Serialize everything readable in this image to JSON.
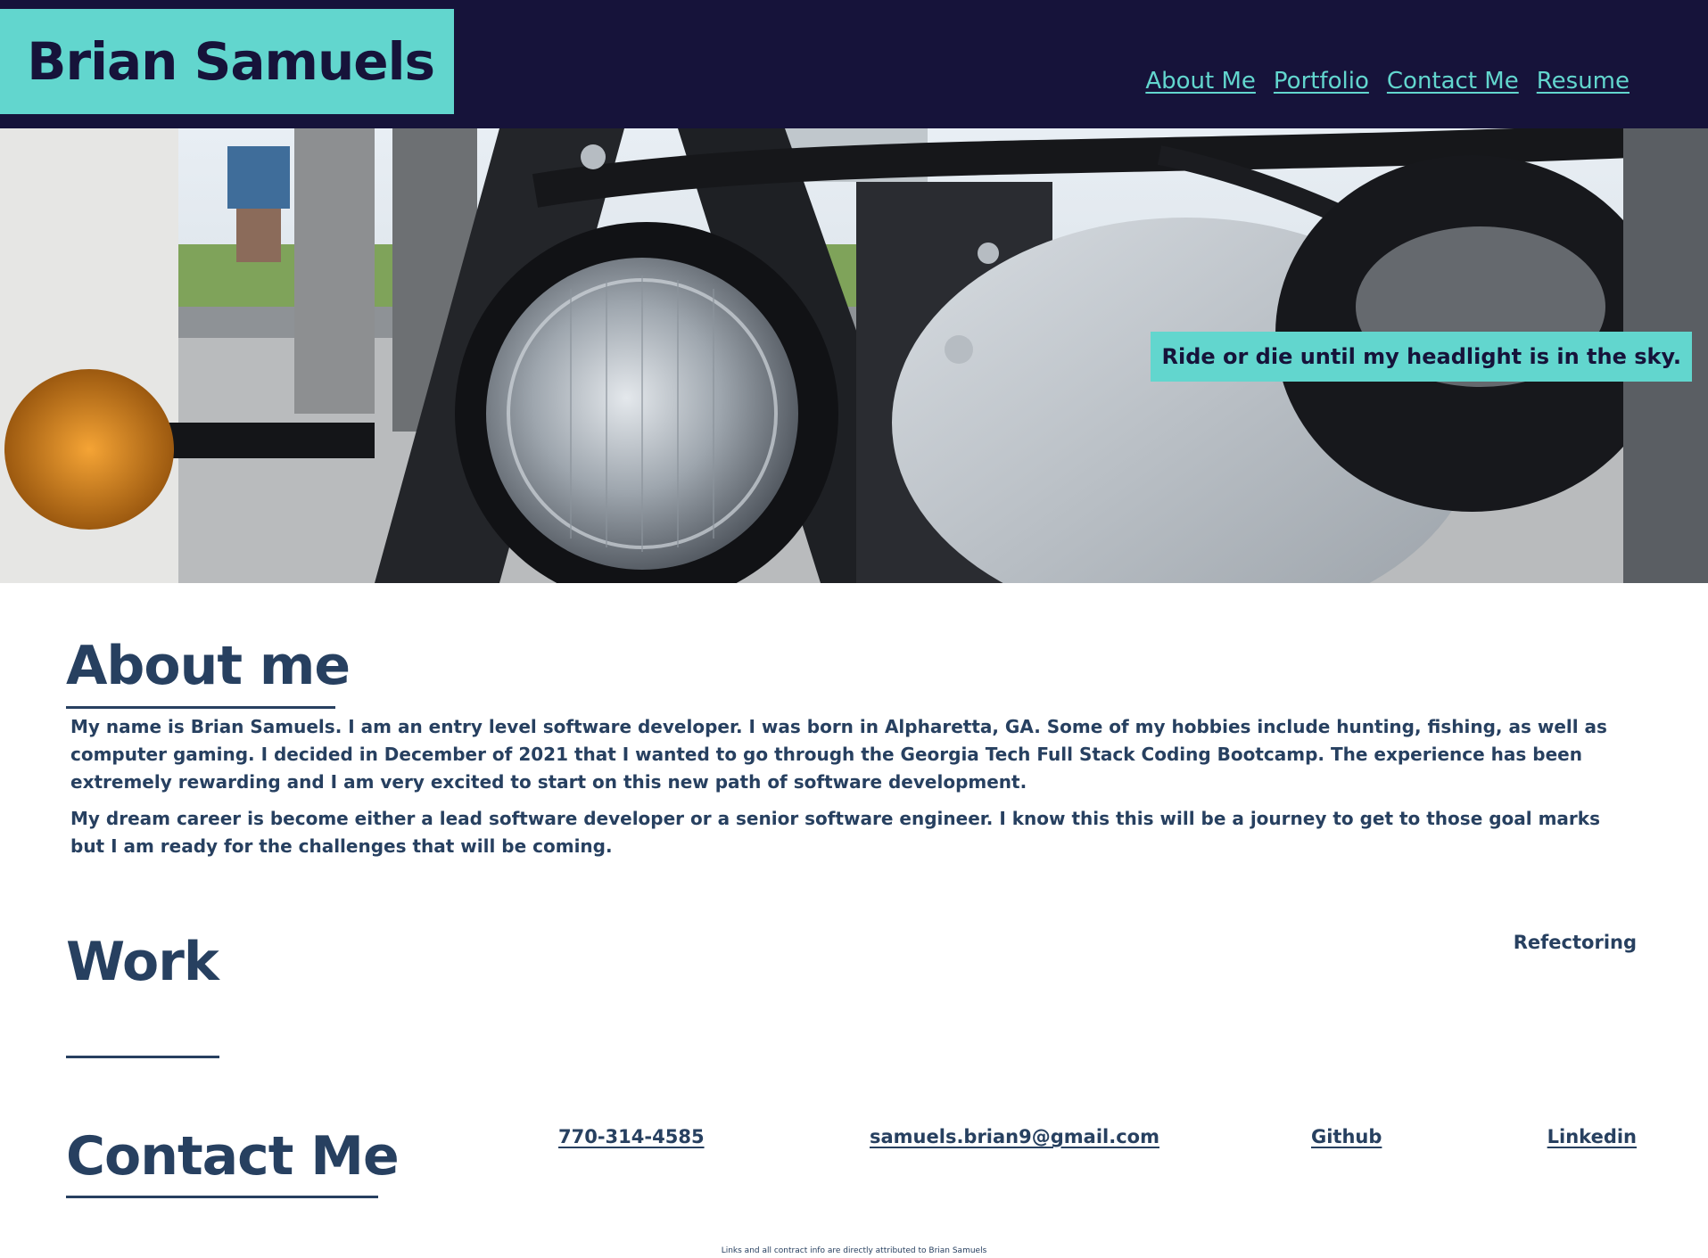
{
  "header": {
    "brand_name": "Brian Samuels",
    "nav": [
      {
        "label": "About Me"
      },
      {
        "label": "Portfolio"
      },
      {
        "label": "Contact Me"
      },
      {
        "label": "Resume"
      }
    ]
  },
  "hero": {
    "image_subject": "motorcycle headlight",
    "tagline": "Ride or die until my headlight is in the sky."
  },
  "about": {
    "title": "About me",
    "paragraphs": [
      "My name is Brian Samuels. I am an entry level software developer. I was born in Alpharetta, GA. Some of my hobbies include hunting, fishing, as well as computer gaming. I decided in December of 2021 that I wanted to go through the Georgia Tech Full Stack Coding Bootcamp. The experience has been extremely rewarding and I am very excited to start on this new path of software development.",
      "My dream career is become either a lead software developer or a senior software engineer. I know this this will be a journey to get to those goal marks but I am ready for the challenges that will be coming."
    ]
  },
  "work": {
    "title": "Work",
    "items": [
      "Refectoring"
    ]
  },
  "contact": {
    "title": "Contact Me",
    "phone": "770-314-4585",
    "email": "samuels.brian9@gmail.com",
    "github": "Github",
    "linkedin": "Linkedin"
  },
  "footer": {
    "note": "Links and all contract info are directly attributed to Brian Samuels"
  },
  "colors": {
    "header_bg": "#16133a",
    "accent": "#62d6ce",
    "text": "#274060",
    "page_bg": "#ffffff"
  }
}
